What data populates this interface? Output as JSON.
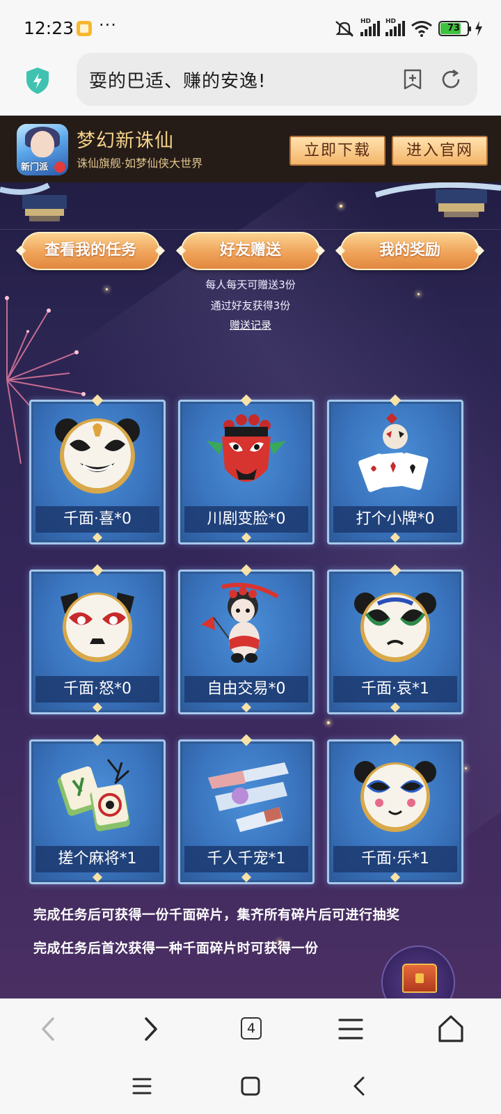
{
  "status_bar": {
    "time": "12:23",
    "more": "···",
    "hd_label": "HD",
    "battery": "73",
    "app_icon": "notes-app-icon",
    "icons": [
      "mute-icon",
      "signal-icon",
      "signal-icon",
      "wifi-icon",
      "battery-icon",
      "charging-icon"
    ]
  },
  "browser": {
    "url_text": "耍的巴适、赚的安逸!",
    "security_icon": "shield-bolt-icon",
    "tab_count": "4"
  },
  "banner": {
    "title": "梦幻新诛仙",
    "subtitle": "诛仙旗舰·如梦仙侠大世界",
    "icon_tag": "新门派",
    "download_label": "立即下载",
    "official_label": "进入官网"
  },
  "actions": {
    "tasks_label": "查看我的任务",
    "gift_label": "好友赠送",
    "rewards_label": "我的奖励",
    "gift_note_1": "每人每天可赠送3份",
    "gift_note_2": "通过好友获得3份",
    "gift_record": "赠送记录"
  },
  "cards": [
    {
      "label": "千面·喜*0",
      "icon": "panda-happy-mask-icon"
    },
    {
      "label": "川剧变脸*0",
      "icon": "sichuan-opera-mask-icon"
    },
    {
      "label": "打个小牌*0",
      "icon": "playing-cards-icon"
    },
    {
      "label": "千面·怒*0",
      "icon": "panda-angry-mask-icon"
    },
    {
      "label": "自由交易*0",
      "icon": "panda-opera-flag-icon"
    },
    {
      "label": "千面·哀*1",
      "icon": "panda-sad-mask-icon"
    },
    {
      "label": "搓个麻将*1",
      "icon": "mahjong-tiles-icon"
    },
    {
      "label": "千人千宠*1",
      "icon": "pet-cards-icon"
    },
    {
      "label": "千面·乐*1",
      "icon": "panda-joy-mask-icon"
    }
  ],
  "rules": {
    "line_1": "完成任务后可获得一份千面碎片，集齐所有碎片后可进行抽奖",
    "line_2": "完成任务后首次获得一种千面碎片时可获得一份"
  },
  "colors": {
    "page_bg_top": "#1e1a3e",
    "page_bg_bottom": "#4a2f63",
    "banner_bg": "#251c18",
    "gold_text": "#f4d28a",
    "pill_orange": "#f0a35a",
    "card_blue": "#3a74be"
  }
}
